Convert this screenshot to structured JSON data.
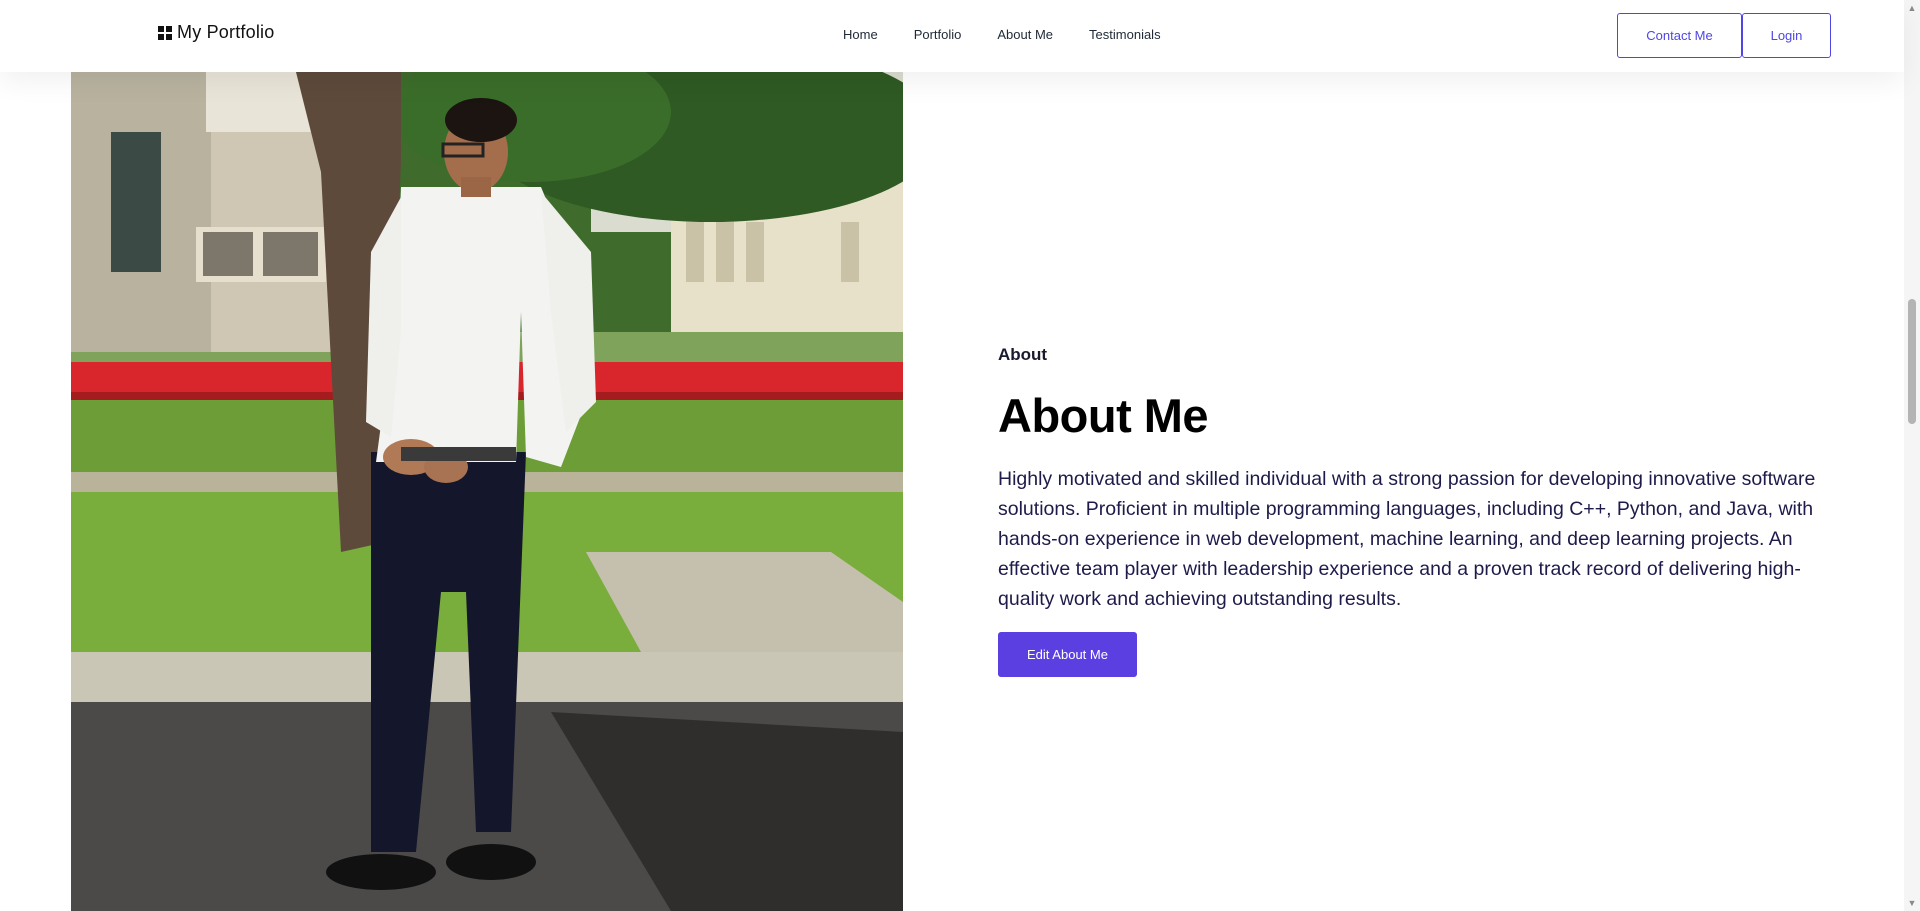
{
  "header": {
    "brand": "My Portfolio",
    "nav": [
      {
        "label": "Home"
      },
      {
        "label": "Portfolio"
      },
      {
        "label": "About Me"
      },
      {
        "label": "Testimonials"
      }
    ],
    "contact_label": "Contact Me",
    "login_label": "Login"
  },
  "about": {
    "eyebrow": "About",
    "title": "About Me",
    "description": "Highly motivated and skilled individual with a strong passion for developing innovative software solutions. Proficient in multiple programming languages, including C++, Python, and Java, with hands-on experience in web development, machine learning, and deep learning projects. An effective team player with leadership experience and a proven track record of delivering high-quality work and achieving outstanding results.",
    "edit_label": "Edit About Me"
  },
  "icons": {
    "brand_logo": "portfolio-logo-icon",
    "scroll_up": "chevron-up-icon",
    "scroll_down": "chevron-down-icon"
  },
  "colors": {
    "accent": "#5b3fe0",
    "outline": "#4f46e5",
    "text": "#1e1b4b"
  }
}
